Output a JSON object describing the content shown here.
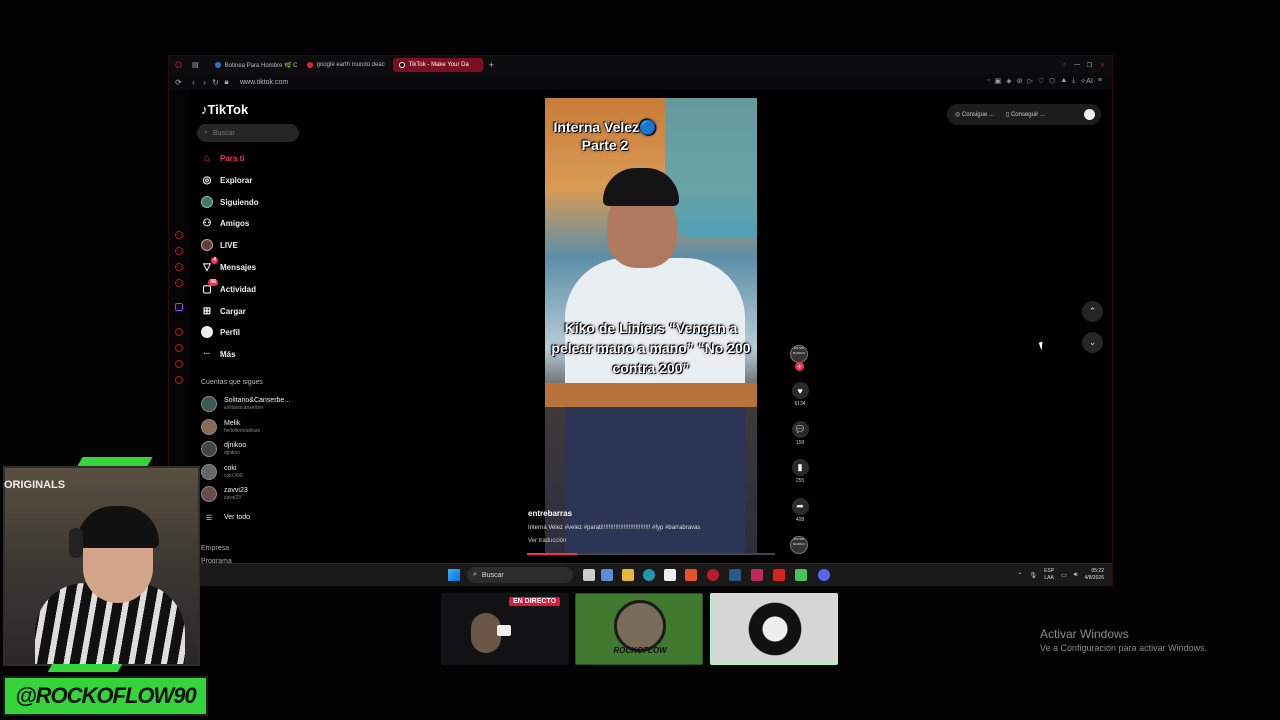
{
  "browser": {
    "tabs": [
      {
        "label": "Botinea Para Hombre 🌿 C",
        "color": "#2b6fd6",
        "active": false
      },
      {
        "label": "google earth mundo deac",
        "color": "#e22",
        "active": false
      },
      {
        "label": "TikTok - Make Your Da",
        "color": "#111",
        "active": true
      }
    ],
    "new_tab": "+",
    "url": "www.tiktok.com",
    "ai_label": "AI"
  },
  "tiktok": {
    "logo": "TikTok",
    "search_placeholder": "Buscar",
    "nav": [
      {
        "label": "Para ti",
        "icon": "home-icon",
        "glyph": "⌂"
      },
      {
        "label": "Explorar",
        "icon": "compass-icon",
        "glyph": "◎"
      },
      {
        "label": "Siguiendo",
        "icon": "following-icon",
        "glyph": "●"
      },
      {
        "label": "Amigos",
        "icon": "friends-icon",
        "glyph": "👥"
      },
      {
        "label": "LIVE",
        "icon": "live-icon",
        "glyph": "●"
      },
      {
        "label": "Mensajes",
        "icon": "messages-icon",
        "glyph": "▽",
        "badge": "4"
      },
      {
        "label": "Actividad",
        "icon": "activity-icon",
        "glyph": "▢",
        "badge": "56"
      },
      {
        "label": "Cargar",
        "icon": "upload-icon",
        "glyph": "⊞"
      },
      {
        "label": "Perfil",
        "icon": "profile-icon",
        "glyph": "○"
      },
      {
        "label": "Más",
        "icon": "more-icon",
        "glyph": "···"
      }
    ],
    "following_title": "Cuentas que sigues",
    "accounts": [
      {
        "name": "Solitario&Canserbe...",
        "handle": "solitariocanserber"
      },
      {
        "name": "Melik",
        "handle": "hellokennadioan"
      },
      {
        "name": "djnikoo",
        "handle": "djnikoo"
      },
      {
        "name": "coki",
        "handle": "coki.999"
      },
      {
        "name": "zavvi23",
        "handle": "zavvi23"
      }
    ],
    "see_all": "Ver todo",
    "footer_company": "Empresa",
    "footer_program": "Programa",
    "chips": {
      "first": "Consigue ...",
      "second": "Conseguir ..."
    }
  },
  "video": {
    "caption_top": "Interna Velez🔵 Parte 2",
    "caption_middle": "Kiko de Liniers “Vengan a pelear mano a mano” “No 200 contra 200”",
    "author": "entrebarras",
    "description": "Interna Velez #velez #parati!!!!!!!!!!!!!!!!!!!!!!!!!!!!! #fyp #barrabravas",
    "translate": "Ver traducción",
    "progress": 0.2,
    "actions": {
      "avatar_text": "ENTRE BARRAS",
      "likes": "6134",
      "comments": "159",
      "saves": "255",
      "shares": "408"
    }
  },
  "taskbar": {
    "search_placeholder": "Buscar",
    "lang_top": "ESP",
    "lang_bottom": "LAA",
    "time": "05:22",
    "date": "4/8/2026"
  },
  "stream": {
    "webcam_label": "ORIGINALS",
    "handle": "@ROCKOFLOW90",
    "live_badge": "EN DIRECTO",
    "thumb_text": "ROCKOFLOW"
  },
  "windows": {
    "activate_title": "Activar Windows",
    "activate_sub": "Ve a Configuración para activar Windows."
  },
  "colors": {
    "accent": "#fe2c55",
    "green": "#35d43a",
    "opera": "#b3172d"
  }
}
